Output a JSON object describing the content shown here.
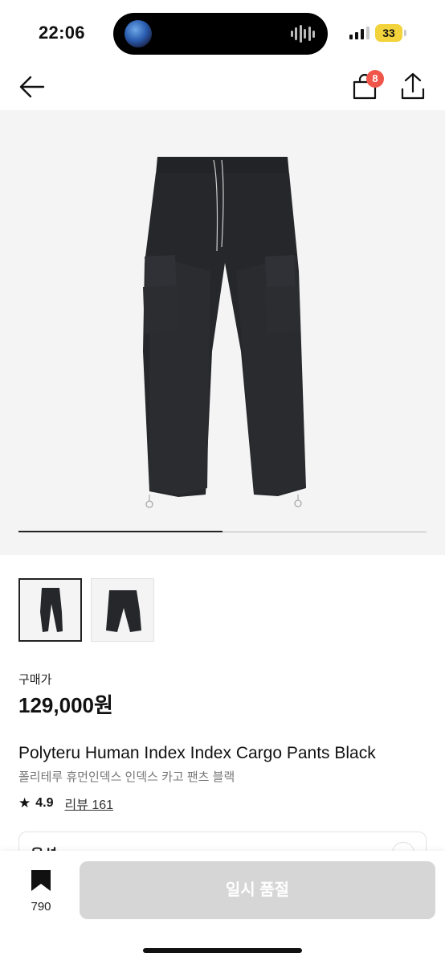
{
  "status_bar": {
    "time": "22:06",
    "battery": "33",
    "battery_color": "#f2d33b"
  },
  "nav": {
    "back_icon": "arrow-left-icon",
    "cart_icon": "shopping-bag-icon",
    "cart_badge": "8",
    "share_icon": "share-icon",
    "badge_color": "#f0554a"
  },
  "gallery": {
    "image_index": 1,
    "image_count": 2,
    "thumbnails": [
      "thumb-1",
      "thumb-2"
    ]
  },
  "price": {
    "label": "구매가",
    "value": "129,000원"
  },
  "product": {
    "name_en": "Polyteru Human Index Index Cargo Pants Black",
    "name_kr": "폴리테루 휴먼인덱스 인덱스 카고 팬츠 블랙",
    "rating": "4.9",
    "reviews": "리뷰 161"
  },
  "option": {
    "label": "옵션"
  },
  "bottom_bar": {
    "bookmark_icon": "bookmark-icon",
    "bookmark_count": "790",
    "button_label": "일시 품절",
    "button_color": "#d6d6d6"
  }
}
